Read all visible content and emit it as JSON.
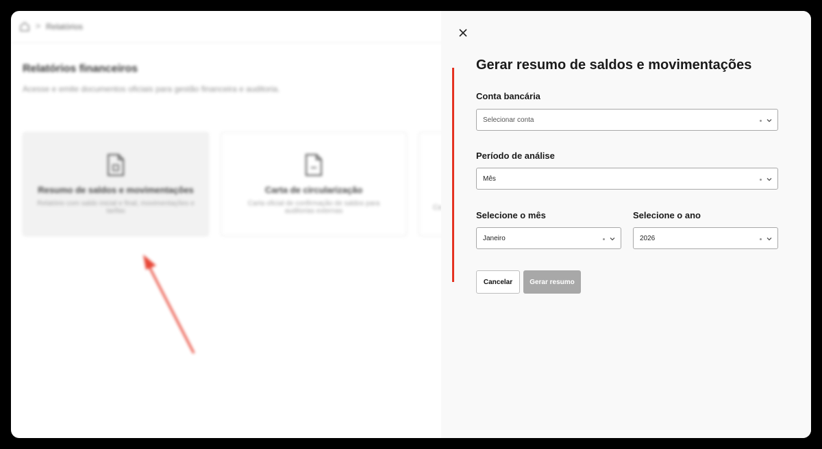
{
  "background": {
    "breadcrumb": {
      "separator": ">",
      "current": "Relatórios"
    },
    "title": "Relatórios financeiros",
    "subtitle": "Acesse e emite documentos oficiais para gestão financeira e auditoria.",
    "cards": [
      {
        "title": "Resumo de saldos e movimentações",
        "desc": "Relatório com saldo inicial e final, movimentações e tarifas"
      },
      {
        "title": "Carta de circularização",
        "desc": "Carta oficial de confirmação de saldos para auditorias externas"
      },
      {
        "title": "",
        "desc": "Ca"
      }
    ]
  },
  "modal": {
    "title": "Gerar resumo de saldos e movimentações",
    "account": {
      "label": "Conta bancária",
      "placeholder": "Selecionar conta"
    },
    "period": {
      "label": "Período de análise",
      "value": "Mês"
    },
    "month": {
      "label": "Selecione o mês",
      "value": "Janeiro"
    },
    "year": {
      "label": "Selecione o ano",
      "value": "2026"
    },
    "cancel_label": "Cancelar",
    "submit_label": "Gerar resumo"
  },
  "colors": {
    "annotation": "#e53322",
    "primary_disabled": "#a8a8a8"
  }
}
